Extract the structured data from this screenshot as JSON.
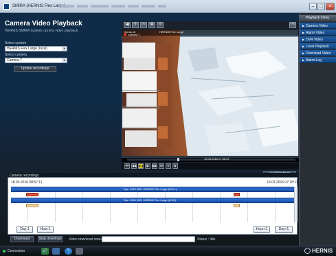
{
  "window": {
    "title": "SMIRA (HERNIS Flex Large)"
  },
  "page": {
    "title": "Camera Video Playback",
    "subtitle": "HERNIS SMIRA System camera video playback."
  },
  "form": {
    "select_system_label": "Select system",
    "system_value": "HERNIS Flex Large (local)",
    "select_camera_label": "Select camera",
    "camera_value": "Camera 7",
    "update_button": "Update recordings"
  },
  "video": {
    "cam_label": "Hernis-10",
    "cam_name": "Camera 7",
    "system_label": "HERNIS Flex Large",
    "timestamp": "19.03.2016 07:05:57",
    "live_button": "Live/Playback",
    "toolbar_icons": [
      "prev-icon",
      "export-icon",
      "snapshot-icon",
      "zoom-icon",
      "fullscreen-icon"
    ]
  },
  "recordings": {
    "header": "Camera recordings",
    "start_time": "18.03.2016 08:57:11",
    "end_time": "19.03.2016 07:18:11",
    "strip1_label": "Sys: 1216 00D: HERNIS Flex Large (FULL)",
    "strip2_label": "Sys: 1216 00D: HERNIS Flex Large (LIVE)",
    "buttons": {
      "day_back": "Day-1",
      "hour_back": "Hour-1",
      "hour_fwd": "Hour+1",
      "day_fwd": "Day+1"
    }
  },
  "bottom": {
    "download": "Download",
    "stop_download": "Stop download",
    "status_label": "Video download status",
    "status_text": "Status : Idle"
  },
  "sidebar": {
    "header": "Playback menu",
    "items": [
      {
        "label": "Camera Video"
      },
      {
        "label": "Alarm Video"
      },
      {
        "label": "DVR Video"
      },
      {
        "label": "Local Playback"
      },
      {
        "label": "Download Video"
      },
      {
        "label": "Alarm Log"
      }
    ]
  },
  "taskbar": {
    "connection_label": "Connection",
    "brand": "HERNIS"
  },
  "colors": {
    "accent_blue": "#1f5ea6",
    "rec_red": "#e0553f",
    "rec_tan": "#f3d8a8",
    "connection_green": "#2fd35a"
  }
}
